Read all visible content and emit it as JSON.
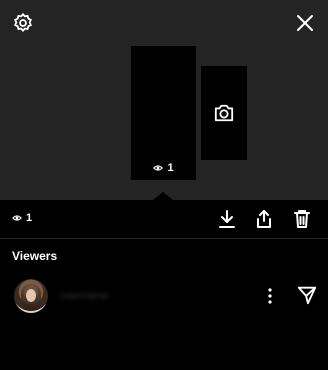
{
  "story": {
    "thumb_view_count": "1"
  },
  "action_bar": {
    "view_count": "1"
  },
  "viewers": {
    "title": "Viewers",
    "items": [
      {
        "username": "username"
      }
    ]
  },
  "icons": {
    "settings": "gear-icon",
    "close": "close-icon",
    "add_story": "camera-icon",
    "views": "eye-icon",
    "download": "download-icon",
    "share": "share-icon",
    "delete": "trash-icon",
    "more": "more-vertical-icon",
    "send": "send-icon"
  },
  "colors": {
    "background": "#000000",
    "top_area": "#242424",
    "text": "#ffffff"
  }
}
